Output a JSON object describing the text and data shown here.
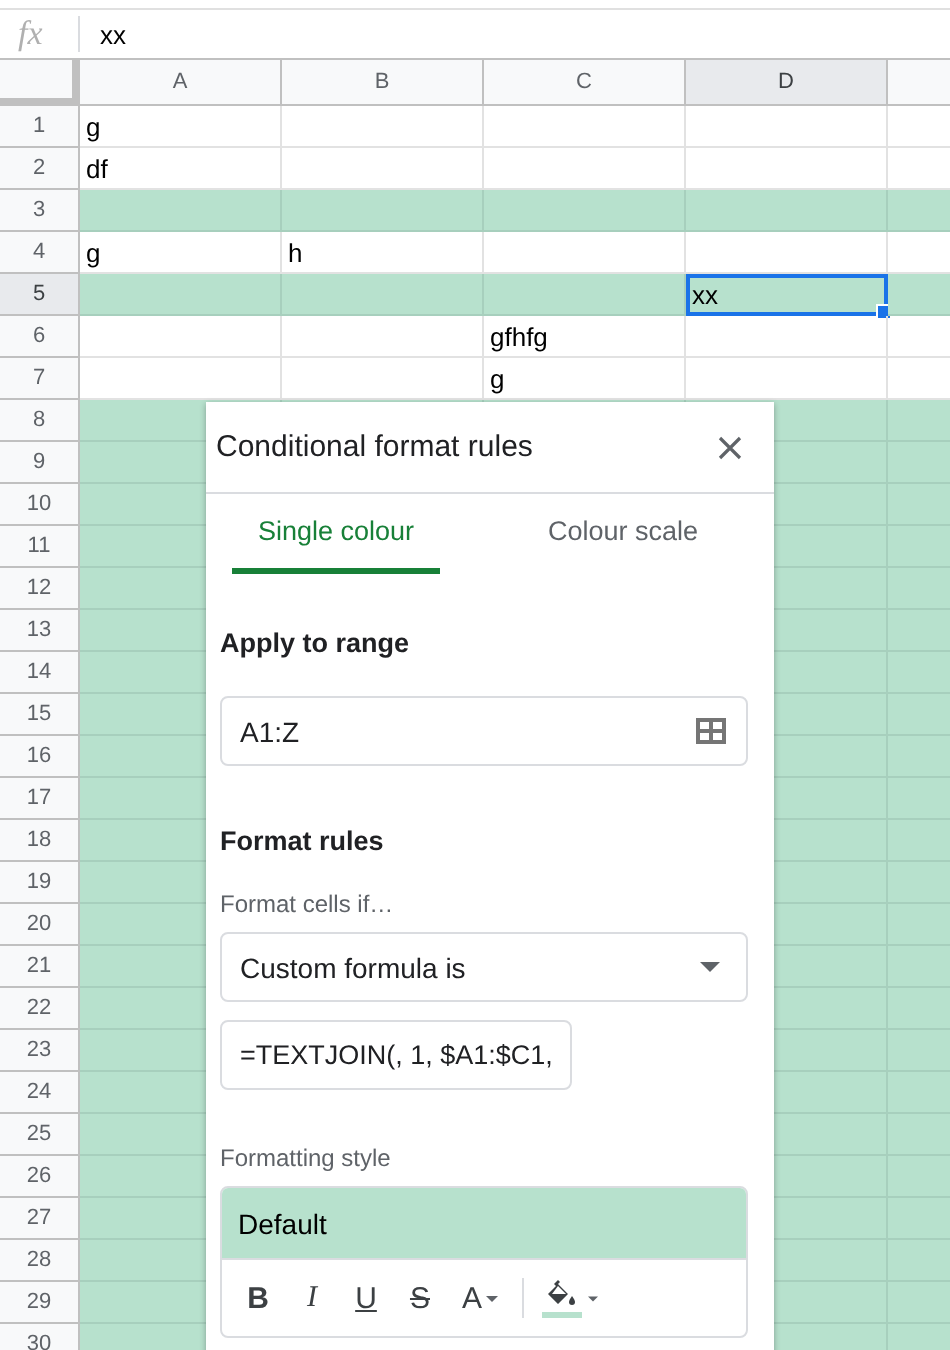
{
  "formula_bar": {
    "icon_text": "fx",
    "value": "xx"
  },
  "columns": [
    {
      "label": "A",
      "selected": false
    },
    {
      "label": "B",
      "selected": false
    },
    {
      "label": "C",
      "selected": false
    },
    {
      "label": "D",
      "selected": true
    }
  ],
  "rows": [
    {
      "number": "1",
      "selected": false,
      "highlighted": false,
      "cells": [
        {
          "text": "g"
        },
        null,
        null,
        null
      ]
    },
    {
      "number": "2",
      "selected": false,
      "highlighted": false,
      "cells": [
        {
          "text": "df"
        },
        null,
        null,
        null
      ]
    },
    {
      "number": "3",
      "selected": false,
      "highlighted": true,
      "cells": [
        null,
        null,
        null,
        null
      ]
    },
    {
      "number": "4",
      "selected": false,
      "highlighted": false,
      "cells": [
        {
          "text": "g"
        },
        {
          "text": "h"
        },
        null,
        null
      ]
    },
    {
      "number": "5",
      "selected": true,
      "highlighted": true,
      "cells": [
        null,
        null,
        null,
        {
          "text": "xx",
          "selected": true
        }
      ]
    },
    {
      "number": "6",
      "selected": false,
      "highlighted": false,
      "cells": [
        null,
        null,
        {
          "text": "gfhfg"
        },
        null
      ]
    },
    {
      "number": "7",
      "selected": false,
      "highlighted": false,
      "cells": [
        null,
        null,
        {
          "text": "g"
        },
        null
      ]
    },
    {
      "number": "8",
      "selected": false,
      "highlighted": true,
      "cells": []
    },
    {
      "number": "9",
      "selected": false,
      "highlighted": true,
      "cells": []
    },
    {
      "number": "10",
      "selected": false,
      "highlighted": true,
      "cells": []
    },
    {
      "number": "11",
      "selected": false,
      "highlighted": true,
      "cells": []
    },
    {
      "number": "12",
      "selected": false,
      "highlighted": true,
      "cells": []
    },
    {
      "number": "13",
      "selected": false,
      "highlighted": true,
      "cells": []
    },
    {
      "number": "14",
      "selected": false,
      "highlighted": true,
      "cells": []
    },
    {
      "number": "15",
      "selected": false,
      "highlighted": true,
      "cells": []
    },
    {
      "number": "16",
      "selected": false,
      "highlighted": true,
      "cells": []
    },
    {
      "number": "17",
      "selected": false,
      "highlighted": true,
      "cells": []
    },
    {
      "number": "18",
      "selected": false,
      "highlighted": true,
      "cells": []
    },
    {
      "number": "19",
      "selected": false,
      "highlighted": true,
      "cells": []
    },
    {
      "number": "20",
      "selected": false,
      "highlighted": true,
      "cells": []
    },
    {
      "number": "21",
      "selected": false,
      "highlighted": true,
      "cells": []
    },
    {
      "number": "22",
      "selected": false,
      "highlighted": true,
      "cells": []
    },
    {
      "number": "23",
      "selected": false,
      "highlighted": true,
      "cells": []
    },
    {
      "number": "24",
      "selected": false,
      "highlighted": true,
      "cells": []
    },
    {
      "number": "25",
      "selected": false,
      "highlighted": true,
      "cells": []
    },
    {
      "number": "26",
      "selected": false,
      "highlighted": true,
      "cells": []
    },
    {
      "number": "27",
      "selected": false,
      "highlighted": true,
      "cells": []
    },
    {
      "number": "28",
      "selected": false,
      "highlighted": true,
      "cells": []
    },
    {
      "number": "29",
      "selected": false,
      "highlighted": true,
      "cells": []
    },
    {
      "number": "30",
      "selected": false,
      "highlighted": true,
      "cells": []
    }
  ],
  "panel": {
    "title": "Conditional format rules",
    "tabs": [
      {
        "label": "Single colour",
        "selected": true
      },
      {
        "label": "Colour scale",
        "selected": false
      }
    ],
    "range_heading": "Apply to range",
    "range_value": "A1:Z",
    "rules_heading": "Format rules",
    "condition_label": "Format cells if…",
    "condition_value": "Custom formula is",
    "formula_value": "=TEXTJOIN(, 1, $A1:$C1,",
    "style_label": "Formatting style",
    "style_preview": "Default",
    "style_tools": [
      {
        "kind": "bold",
        "label": "B"
      },
      {
        "kind": "italic",
        "label": "I"
      },
      {
        "kind": "underline",
        "label": "U"
      },
      {
        "kind": "strike",
        "label": "S"
      },
      {
        "kind": "textcolour",
        "label": "A"
      },
      {
        "kind": "fill",
        "color": "#b7e1cd"
      }
    ]
  }
}
